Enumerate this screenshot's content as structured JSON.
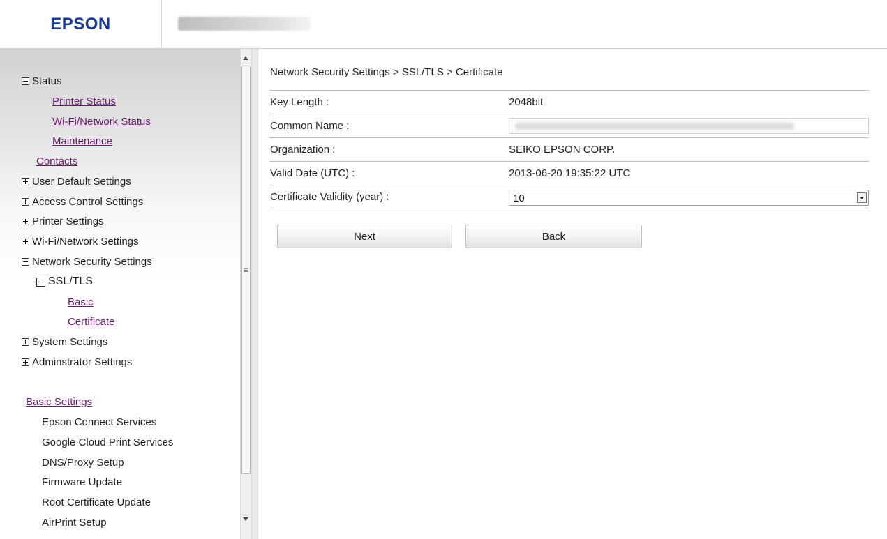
{
  "header": {
    "logo": "EPSON"
  },
  "sidebar": {
    "status": "Status",
    "printer_status": "Printer Status",
    "wifi_status": "Wi-Fi/Network Status",
    "maintenance": "Maintenance",
    "contacts": "Contacts",
    "user_default": "User Default Settings",
    "access_control": "Access Control Settings",
    "printer_settings": "Printer Settings",
    "wifi_settings": "Wi-Fi/Network Settings",
    "network_security": "Network Security Settings",
    "ssl_tls": "SSL/TLS",
    "basic": "Basic",
    "certificate": "Certificate",
    "system_settings": "System Settings",
    "admin_settings": "Adminstrator Settings",
    "basic_settings": "Basic Settings",
    "epson_connect": "Epson Connect Services",
    "google_cloud": "Google Cloud Print Services",
    "dns_proxy": "DNS/Proxy Setup",
    "firmware": "Firmware Update",
    "root_cert": "Root Certificate Update",
    "airprint": "AirPrint Setup"
  },
  "main": {
    "breadcrumb": "Network Security Settings > SSL/TLS > Certificate",
    "rows": {
      "key_length_label": "Key Length :",
      "key_length_value": "2048bit",
      "common_name_label": "Common Name :",
      "organization_label": "Organization :",
      "organization_value": "SEIKO EPSON CORP.",
      "valid_date_label": "Valid Date (UTC) :",
      "valid_date_value": "2013-06-20 19:35:22 UTC",
      "validity_label": "Certificate Validity (year) :",
      "validity_value": "10"
    },
    "next_button": "Next",
    "back_button": "Back"
  }
}
